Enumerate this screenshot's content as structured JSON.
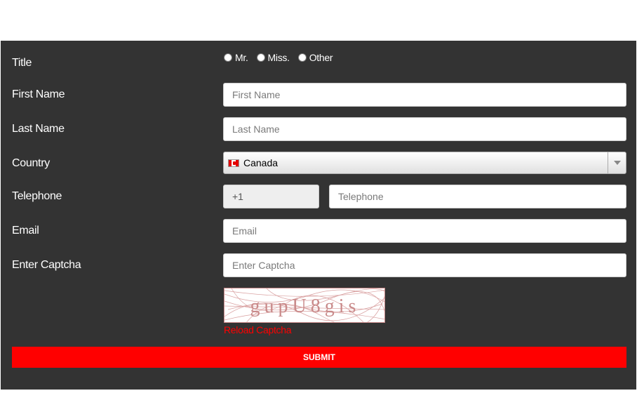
{
  "form": {
    "title_label": "Title",
    "title_options": [
      "Mr.",
      "Miss.",
      "Other"
    ],
    "first_name_label": "First Name",
    "first_name_placeholder": "First Name",
    "last_name_label": "Last Name",
    "last_name_placeholder": "Last Name",
    "country_label": "Country",
    "country_value": "Canada",
    "country_flag_icon": "canada-flag-icon",
    "telephone_label": "Telephone",
    "dial_code": "+1",
    "telephone_placeholder": "Telephone",
    "email_label": "Email",
    "email_placeholder": "Email",
    "captcha_label": "Enter Captcha",
    "captcha_placeholder": "Enter Captcha",
    "captcha_text": "gupU8gis",
    "reload_label": "Reload Captcha",
    "submit_label": "SUBMIT"
  },
  "colors": {
    "panel": "#333333",
    "accent": "#ff0000",
    "captcha_ink": "#c98a8a"
  }
}
